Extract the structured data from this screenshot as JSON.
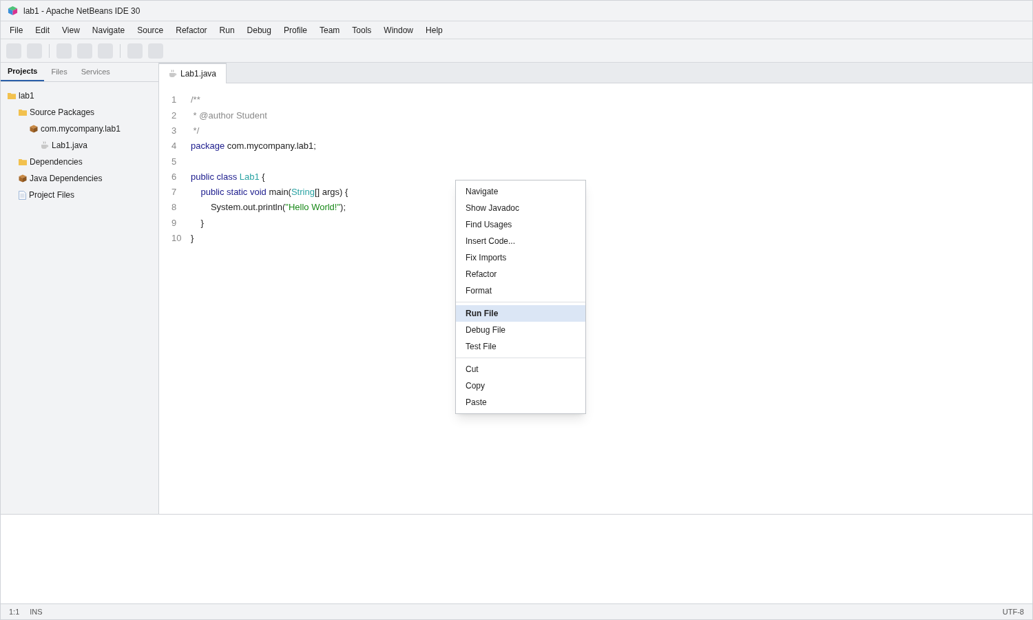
{
  "window": {
    "title": "lab1 - Apache NetBeans IDE 30"
  },
  "menu_bar": [
    "File",
    "Edit",
    "View",
    "Navigate",
    "Source",
    "Refactor",
    "Run",
    "Debug",
    "Profile",
    "Team",
    "Tools",
    "Window",
    "Help"
  ],
  "side_tabs": [
    {
      "label": "Projects",
      "selected": true
    },
    {
      "label": "Files",
      "selected": false
    },
    {
      "label": "Services",
      "selected": false
    }
  ],
  "project_tree": [
    {
      "label": "lab1",
      "kind": "folder",
      "children": [
        {
          "label": "Source Packages",
          "kind": "folder",
          "children": [
            {
              "label": "com.mycompany.lab1",
              "kind": "package",
              "children": [
                {
                  "label": "Lab1.java",
                  "kind": "java"
                }
              ]
            }
          ]
        },
        {
          "label": "Dependencies",
          "kind": "folder"
        },
        {
          "label": "Java Dependencies",
          "kind": "package"
        },
        {
          "label": "Project Files",
          "kind": "file"
        }
      ]
    }
  ],
  "editor_tabs": [
    {
      "label": "Lab1.java",
      "selected": true
    }
  ],
  "code_lines": [
    {
      "number": "1",
      "tokens": [
        {
          "kind": "comment",
          "text": "/**"
        }
      ]
    },
    {
      "number": "2",
      "tokens": [
        {
          "kind": "comment",
          "text": " * @author Student"
        }
      ]
    },
    {
      "number": "3",
      "tokens": [
        {
          "kind": "comment",
          "text": " */"
        }
      ]
    },
    {
      "number": "4",
      "tokens": [
        {
          "kind": "keyword",
          "text": "package"
        },
        {
          "kind": "plain",
          "text": " com.mycompany.lab1;"
        }
      ]
    },
    {
      "number": "5"
    },
    {
      "number": "6",
      "tokens": [
        {
          "kind": "keyword",
          "text": "public class "
        },
        {
          "kind": "type",
          "text": "Lab1"
        },
        {
          "kind": "plain",
          "text": " {"
        }
      ]
    },
    {
      "number": "7",
      "tokens": [
        {
          "kind": "keyword",
          "text": "    public static void"
        },
        {
          "kind": "plain",
          "text": " main("
        },
        {
          "kind": "type",
          "text": "String"
        },
        {
          "kind": "plain",
          "text": "[] args) {"
        }
      ]
    },
    {
      "number": "8",
      "tokens": [
        {
          "kind": "plain",
          "text": "        System.out.println("
        },
        {
          "kind": "string",
          "text": "\"Hello World!\""
        },
        {
          "kind": "plain",
          "text": ");"
        }
      ]
    },
    {
      "number": "9",
      "tokens": [
        {
          "kind": "plain",
          "text": "    }"
        }
      ]
    },
    {
      "number": "10",
      "tokens": [
        {
          "kind": "plain",
          "text": "}"
        }
      ]
    }
  ],
  "context_menu": [
    [
      {
        "label": "Navigate",
        "selected": false
      },
      {
        "label": "Show Javadoc",
        "selected": false
      },
      {
        "label": "Find Usages",
        "selected": false
      },
      {
        "label": "Insert Code...",
        "selected": false
      },
      {
        "label": "Fix Imports",
        "selected": false
      },
      {
        "label": "Refactor",
        "selected": false
      },
      {
        "label": "Format",
        "selected": false
      }
    ],
    [
      {
        "label": "Run File",
        "selected": true
      },
      {
        "label": "Debug File",
        "selected": false
      },
      {
        "label": "Test File",
        "selected": false
      }
    ],
    [
      {
        "label": "Cut",
        "selected": false
      },
      {
        "label": "Copy",
        "selected": false
      },
      {
        "label": "Paste",
        "selected": false
      }
    ]
  ],
  "status_bar": {
    "position": "1:1",
    "mode": "INS",
    "encoding": "UTF-8"
  }
}
